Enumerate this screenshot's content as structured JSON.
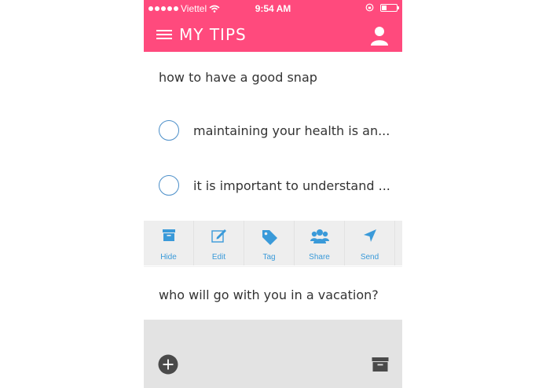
{
  "status_bar": {
    "carrier": "Viettel",
    "time": "9:54 AM"
  },
  "header": {
    "title": "MY TIPS",
    "menu_icon": "hamburger-icon",
    "profile_icon": "person-icon"
  },
  "tips": [
    {
      "title": "how to have a good snap",
      "items": [
        "maintaining your health is an...",
        "it is important to understand ..."
      ]
    },
    {
      "title": "who will go with you in a vacation?"
    }
  ],
  "actions": [
    {
      "label": "Hide",
      "icon": "archive-icon"
    },
    {
      "label": "Edit",
      "icon": "edit-icon"
    },
    {
      "label": "Tag",
      "icon": "tag-icon"
    },
    {
      "label": "Share",
      "icon": "group-icon"
    },
    {
      "label": "Send",
      "icon": "send-icon"
    }
  ],
  "colors": {
    "accent": "#ff4a7d",
    "action_blue": "#3a9ad9",
    "checkbox_blue": "#4c8fc9"
  }
}
